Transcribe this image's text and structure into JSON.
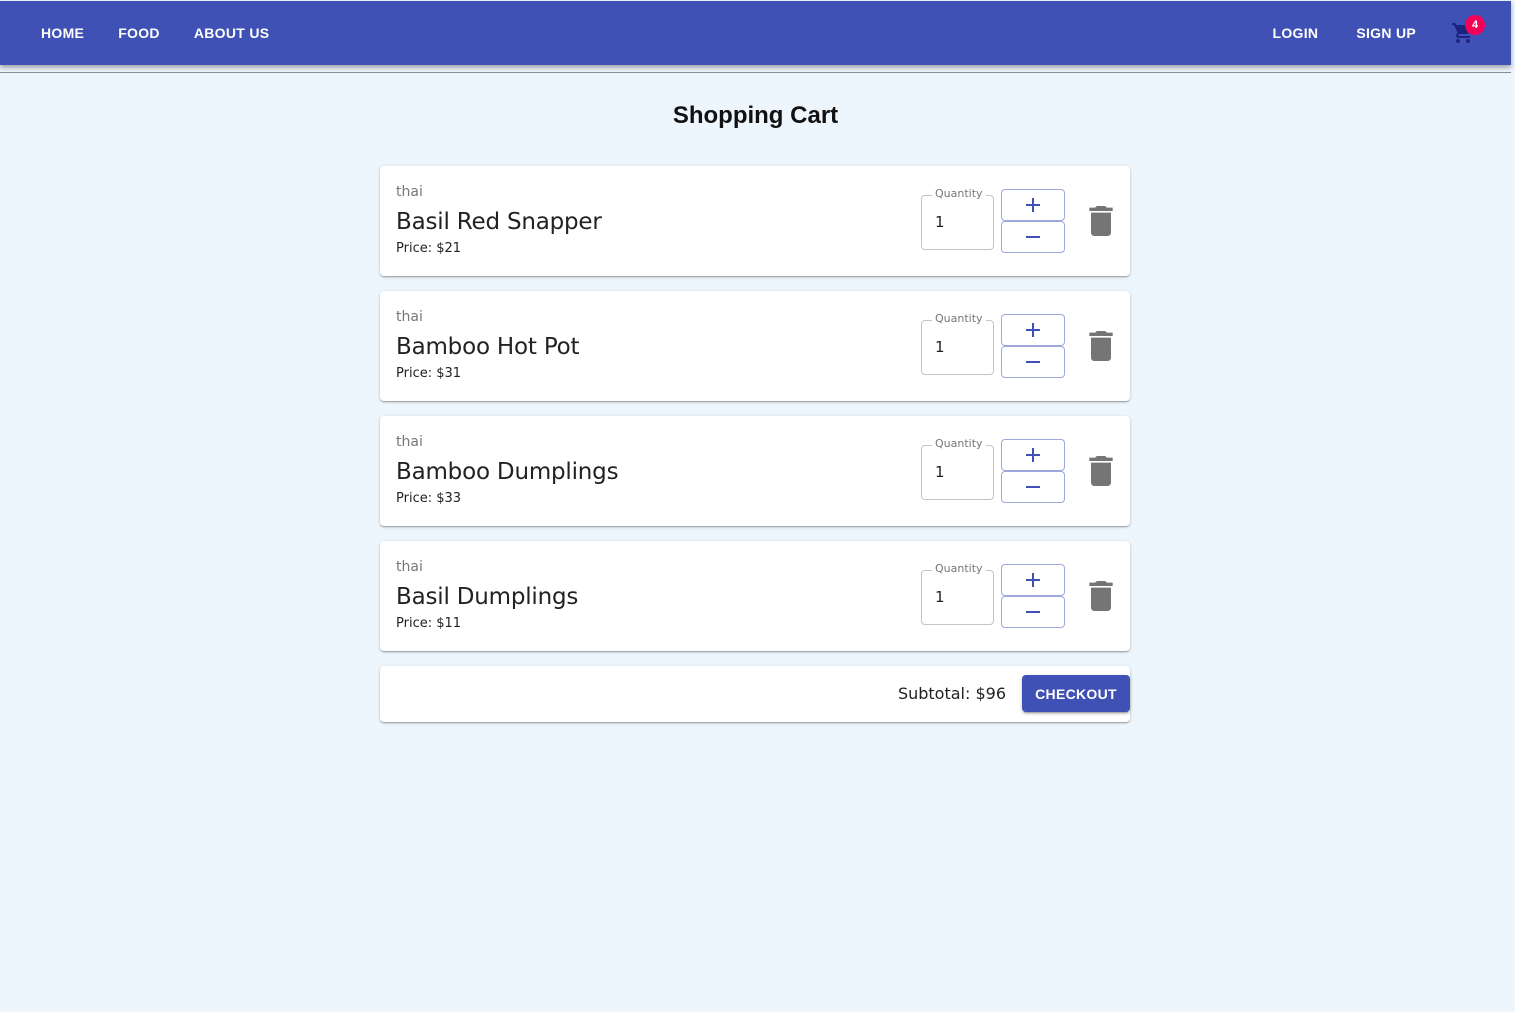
{
  "nav": {
    "left": [
      "HOME",
      "FOOD",
      "ABOUT US"
    ],
    "right": [
      "LOGIN",
      "SIGN UP"
    ],
    "cart_count": "4",
    "cart_icon": "shopping-cart-icon"
  },
  "colors": {
    "appbar": "#3f51b5",
    "badge": "#f50057",
    "page_bg": "#eef6fd"
  },
  "page_title": "Shopping Cart",
  "cart": {
    "quantity_label": "Quantity",
    "items": [
      {
        "category": "thai",
        "name": "Basil Red Snapper",
        "price": "Price: $21",
        "quantity": "1"
      },
      {
        "category": "thai",
        "name": "Bamboo Hot Pot",
        "price": "Price: $31",
        "quantity": "1"
      },
      {
        "category": "thai",
        "name": "Bamboo Dumplings",
        "price": "Price: $33",
        "quantity": "1"
      },
      {
        "category": "thai",
        "name": "Basil Dumplings",
        "price": "Price: $11",
        "quantity": "1"
      }
    ]
  },
  "summary": {
    "subtotal": "Subtotal: $96",
    "checkout_label": "CHECKOUT"
  }
}
